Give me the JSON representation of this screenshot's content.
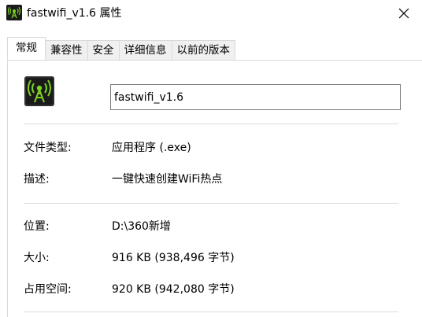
{
  "window": {
    "title": "fastwifi_v1.6 属性"
  },
  "tabs": [
    {
      "label": "常规",
      "active": true
    },
    {
      "label": "兼容性",
      "active": false
    },
    {
      "label": "安全",
      "active": false
    },
    {
      "label": "详细信息",
      "active": false
    },
    {
      "label": "以前的版本",
      "active": false
    }
  ],
  "general": {
    "file_name": "fastwifi_v1.6",
    "rows": [
      {
        "label": "文件类型:",
        "value": "应用程序 (.exe)"
      },
      {
        "label": "描述:",
        "value": "一键快速创建WiFi热点"
      },
      {
        "label": "位置:",
        "value": "D:\\360新增"
      },
      {
        "label": "大小:",
        "value": "916 KB (938,496 字节)"
      },
      {
        "label": "占用空间:",
        "value": "920 KB (942,080 字节)"
      }
    ]
  },
  "colors": {
    "icon_background": "#1a1a1a",
    "icon_accent": "#7ed321",
    "tab_inactive": "#f0f0f0",
    "border": "#d9d9d9"
  },
  "icons": {
    "app": "wifi-antenna-icon",
    "close": "close-icon"
  }
}
